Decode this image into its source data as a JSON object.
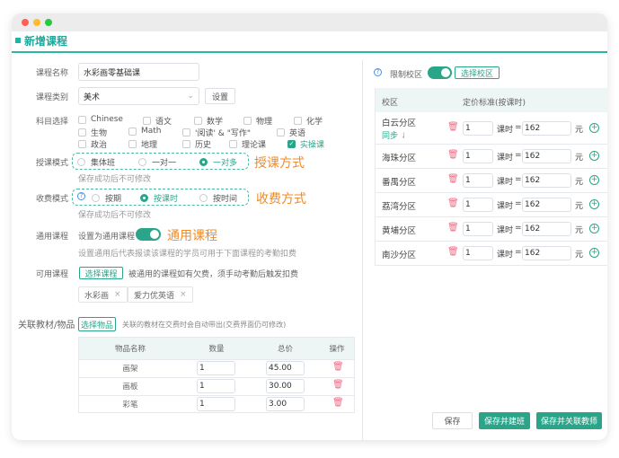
{
  "page": {
    "title": "新增课程"
  },
  "form": {
    "name_label": "课程名称",
    "name_value": "水彩画零基础课",
    "category_label": "课程类别",
    "category_value": "美术",
    "settings_button": "设置",
    "subject_label": "科目选择",
    "subjects": [
      {
        "label": "Chinese",
        "checked": false
      },
      {
        "label": "语文",
        "checked": false
      },
      {
        "label": "数学",
        "checked": false
      },
      {
        "label": "物理",
        "checked": false
      },
      {
        "label": "化学",
        "checked": false
      },
      {
        "label": "生物",
        "checked": false
      },
      {
        "label": "Math",
        "checked": false
      },
      {
        "label": "'阅读' & \"写作\"",
        "checked": false
      },
      {
        "label": "英语",
        "checked": false
      },
      {
        "label": "政治",
        "checked": false
      },
      {
        "label": "地理",
        "checked": false
      },
      {
        "label": "历史",
        "checked": false
      },
      {
        "label": "理论课",
        "checked": false
      },
      {
        "label": "实操课",
        "checked": true
      }
    ],
    "teach_mode_label": "授课模式",
    "teach_modes": [
      "集体班",
      "一对一",
      "一对多"
    ],
    "teach_mode_selected": "一对多",
    "teach_mode_annotation": "授课方式",
    "teach_mode_hint": "保存成功后不可修改",
    "fee_mode_label": "收费模式",
    "fee_modes": [
      "按期",
      "按课时",
      "按时间"
    ],
    "fee_mode_selected": "按课时",
    "fee_mode_annotation": "收费方式",
    "fee_mode_hint": "保存成功后不可修改",
    "general_label": "通用课程",
    "general_toggle_label": "设置为通用课程",
    "general_on": true,
    "general_annotation": "通用课程",
    "general_desc": "设置通用后代表报读该课程的学员可用于下面课程的考勤扣费",
    "available_label": "可用课程",
    "select_course_button": "选择课程",
    "available_hint": "被通用的课程如有欠费，须手动考勤后触发扣费",
    "tags": [
      "水彩画",
      "爱力优英语"
    ],
    "materials_label": "关联教材/物品",
    "select_items_button": "选择物品",
    "materials_hint": "关联的教材在交费时会自动带出(交费界面仍可修改)",
    "materials_table": {
      "headers": [
        "物品名称",
        "数量",
        "总价",
        "操作"
      ],
      "rows": [
        {
          "name": "画架",
          "qty": "1",
          "price": "45.00"
        },
        {
          "name": "画板",
          "qty": "1",
          "price": "30.00"
        },
        {
          "name": "彩笔",
          "qty": "1",
          "price": "3.00"
        }
      ]
    }
  },
  "campus": {
    "limit_label": "限制校区",
    "limit_on": true,
    "select_button": "选择校区",
    "headers": [
      "校区",
      "定价标准(按课时)"
    ],
    "sync_label": "同步",
    "unit_label": "课时",
    "equals": "=",
    "currency": "元",
    "rows": [
      {
        "name": "白云分区",
        "lessons": "1",
        "price": "162"
      },
      {
        "name": "海珠分区",
        "lessons": "1",
        "price": "162"
      },
      {
        "name": "番禺分区",
        "lessons": "1",
        "price": "162"
      },
      {
        "name": "荔湾分区",
        "lessons": "1",
        "price": "162"
      },
      {
        "name": "黄埔分区",
        "lessons": "1",
        "price": "162"
      },
      {
        "name": "南沙分区",
        "lessons": "1",
        "price": "162"
      }
    ]
  },
  "footer": {
    "save": "保存",
    "save_class": "保存并建班",
    "save_teacher": "保存并关联教师"
  },
  "colors": {
    "accent": "#2aa58a",
    "annotation": "#f08a24",
    "danger": "#f06a84"
  }
}
